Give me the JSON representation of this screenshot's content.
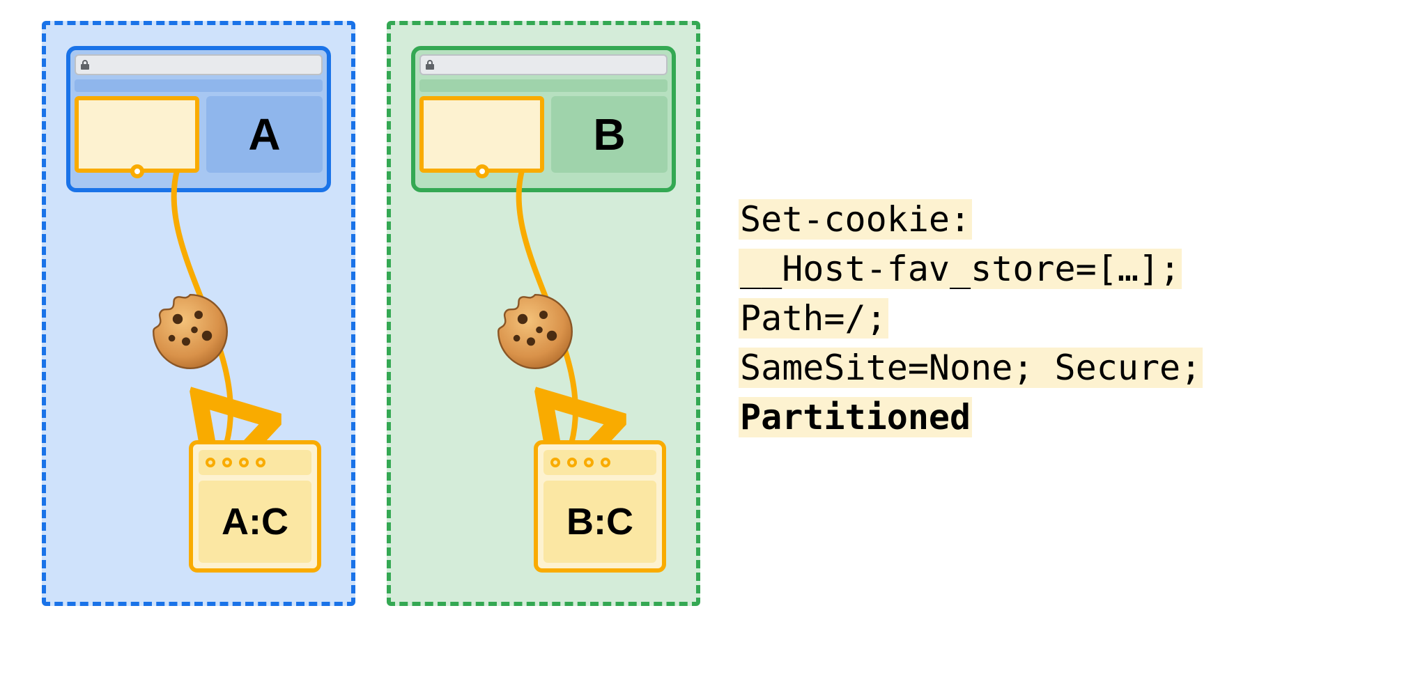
{
  "diagram": {
    "partitions": [
      {
        "site_label": "A",
        "jar_label": "A:C",
        "theme": "blue"
      },
      {
        "site_label": "B",
        "jar_label": "B:C",
        "theme": "green"
      }
    ]
  },
  "code": {
    "line1": "Set-cookie:",
    "line2": "__Host-fav_store=[…];",
    "line3": "Path=/;",
    "line4": "SameSite=None; Secure;",
    "line5": "Partitioned"
  },
  "icons": {
    "lock": "lock-icon",
    "cookie": "cookie-icon"
  }
}
